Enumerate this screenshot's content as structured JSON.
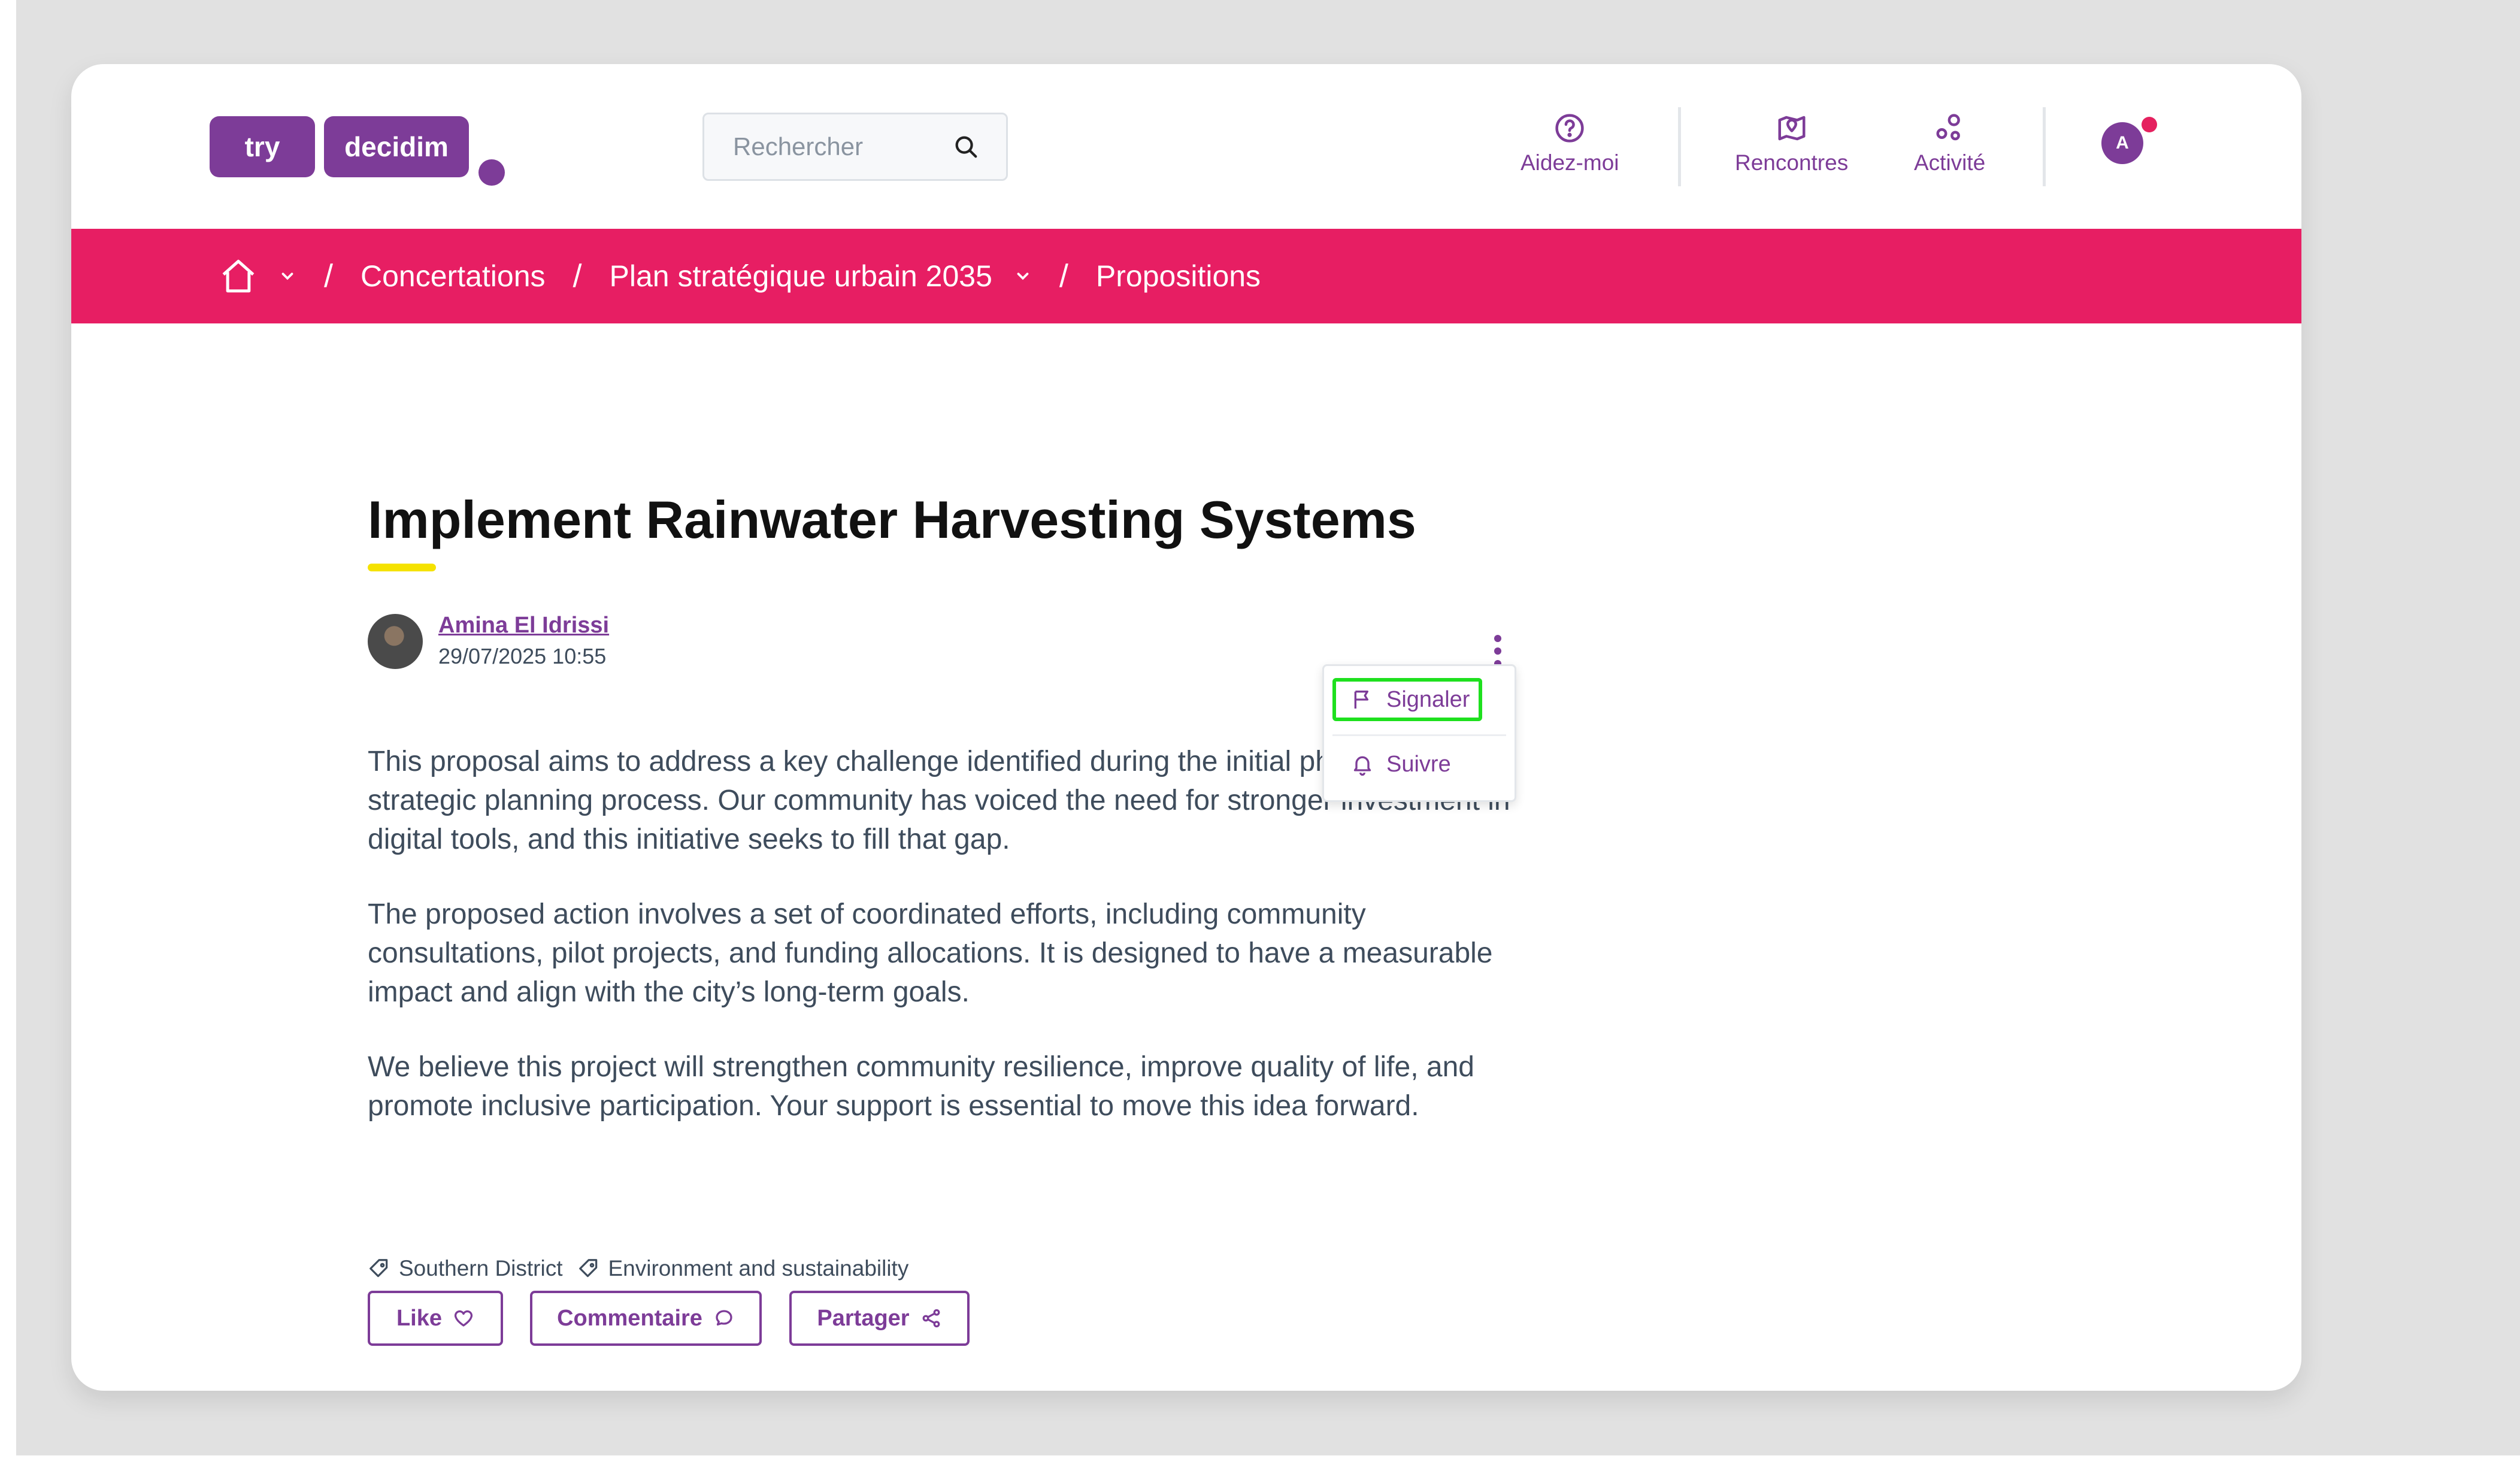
{
  "header": {
    "logo_try": "try",
    "logo_decidim": "decidim",
    "search_placeholder": "Rechercher",
    "nav": {
      "help_label": "Aidez-moi",
      "meetings_label": "Rencontres",
      "activity_label": "Activité"
    },
    "user_initial": "A"
  },
  "breadcrumb": {
    "items": [
      "Concertations",
      "Plan stratégique urbain 2035",
      "Propositions"
    ],
    "separator": "/"
  },
  "proposal": {
    "title": "Implement Rainwater Harvesting Systems",
    "author_name": "Amina El Idrissi",
    "date": "29/07/2025 10:55",
    "paragraphs": [
      [
        "This proposal aims to address a key challenge identified during the initial phase of the",
        "strategic planning process. Our community has voiced the need for stronger investment in",
        "digital tools, and this initiative seeks to fill that gap."
      ],
      [
        "The proposed action involves a set of coordinated efforts, including community",
        "consultations, pilot projects, and funding allocations. It is designed to have a measurable",
        "impact and align with the city’s long-term goals."
      ],
      [
        "We believe this project will strengthen community resilience, improve quality of life, and",
        "promote inclusive participation. Your support is essential to move this idea forward."
      ]
    ],
    "tags": [
      "Southern District",
      "Environment and sustainability"
    ],
    "actions": {
      "like": "Like",
      "comment": "Commentaire",
      "share": "Partager"
    }
  },
  "menu": {
    "report": "Signaler",
    "follow": "Suivre"
  },
  "colors": {
    "brand_purple": "#7d3c98",
    "breadcrumb_bg": "#e71e63",
    "title_accent": "#f5e200",
    "highlight": "#1ee01e",
    "notification": "#e5215f"
  }
}
